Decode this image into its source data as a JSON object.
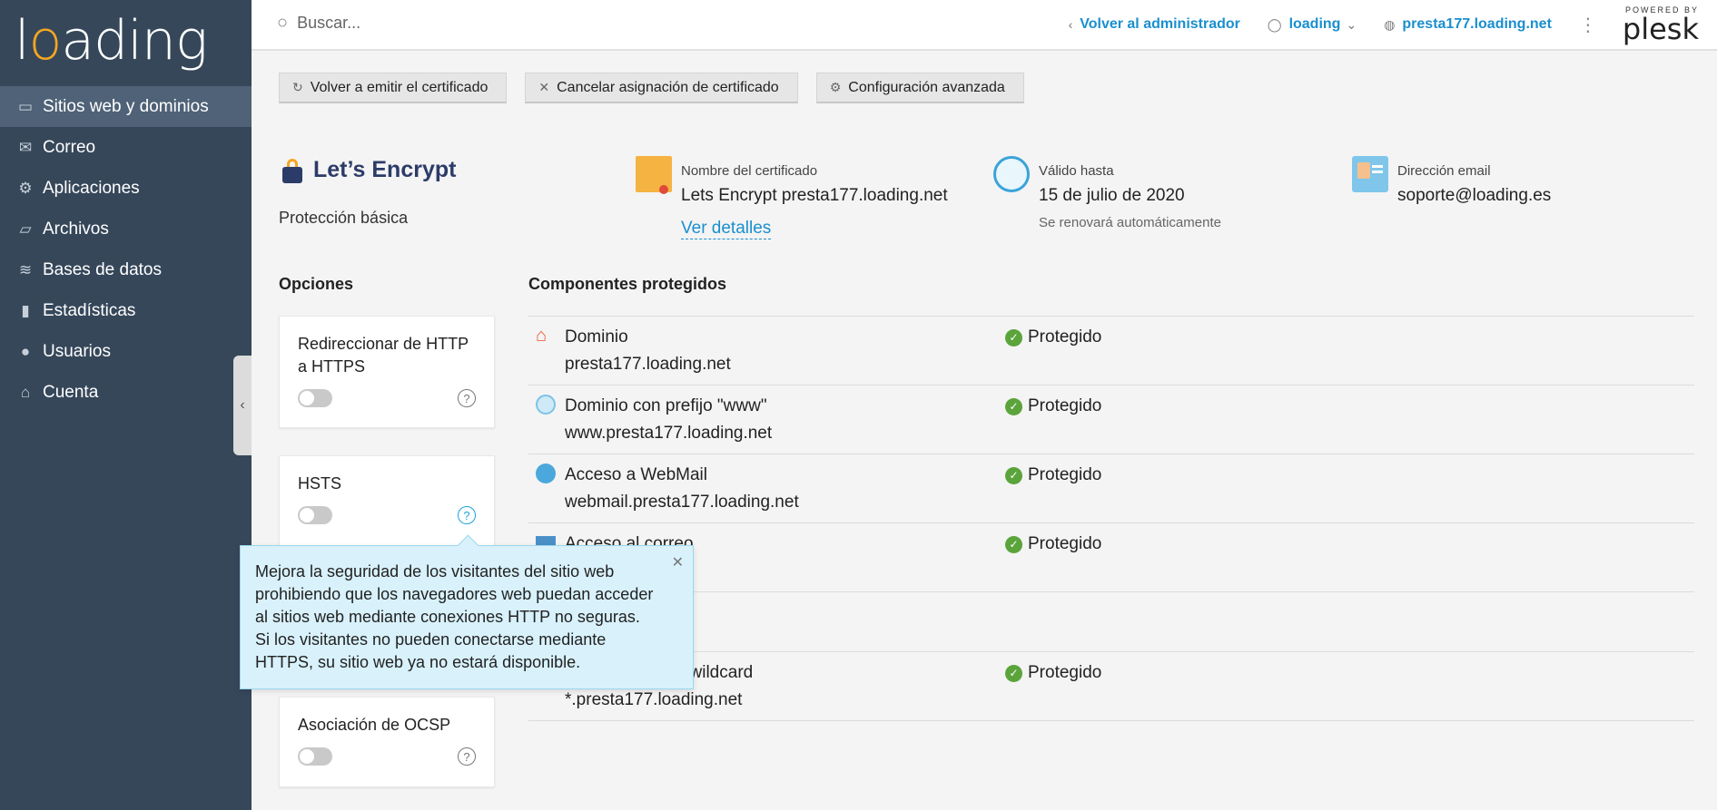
{
  "sidebar": {
    "logo": "loading",
    "items": [
      {
        "label": "Sitios web y dominios",
        "icon": "monitor-icon"
      },
      {
        "label": "Correo",
        "icon": "mail-icon"
      },
      {
        "label": "Aplicaciones",
        "icon": "gear-icon"
      },
      {
        "label": "Archivos",
        "icon": "folder-icon"
      },
      {
        "label": "Bases de datos",
        "icon": "database-icon"
      },
      {
        "label": "Estadísticas",
        "icon": "bar-chart-icon"
      },
      {
        "label": "Usuarios",
        "icon": "user-icon"
      },
      {
        "label": "Cuenta",
        "icon": "account-icon"
      }
    ]
  },
  "topbar": {
    "search_placeholder": "Buscar...",
    "back_admin": "Volver al administrador",
    "user": "loading",
    "domain": "presta177.loading.net",
    "powered_by": "POWERED BY",
    "brand": "plesk"
  },
  "toolbar": {
    "reissue": "Volver a emitir el certificado",
    "cancel": "Cancelar asignación de certificado",
    "advanced": "Configuración avanzada"
  },
  "certificate": {
    "provider": "Let’s Encrypt",
    "protection": "Protección básica",
    "name_label": "Nombre del certificado",
    "name_value": "Lets Encrypt presta177.loading.net",
    "details_link": "Ver detalles",
    "valid_label": "Válido hasta",
    "valid_value": "15 de julio de 2020",
    "renew_note": "Se renovará automáticamente",
    "email_label": "Dirección email",
    "email_value": "soporte@loading.es"
  },
  "options": {
    "heading": "Opciones",
    "items": [
      {
        "title": "Redireccionar de HTTP a HTTPS",
        "enabled": false
      },
      {
        "title": "HSTS",
        "enabled": false
      },
      {
        "title": "Asociación de OCSP",
        "enabled": false
      }
    ],
    "help_glyph": "?"
  },
  "tooltip": {
    "text": "Mejora la seguridad de los visitantes del sitio web prohibiendo que los navegadores web puedan acceder al sitios web mediante conexiones HTTP no seguras. Si los visitantes no pueden conectarse mediante HTTPS, su sitio web ya no estará disponible."
  },
  "components": {
    "heading": "Componentes protegidos",
    "rows": [
      {
        "name": "Dominio",
        "domain": "presta177.loading.net",
        "status": "Protegido",
        "icon": "house-icon"
      },
      {
        "name": "Dominio con prefijo \"www\"",
        "domain": "www.presta177.loading.net",
        "status": "Protegido",
        "icon": "www-icon"
      },
      {
        "name": "Acceso a WebMail",
        "domain": "webmail.presta177.loading.net",
        "status": "Protegido",
        "icon": "globe-icon"
      },
      {
        "name": "Acceso al correo",
        "domain": "",
        "status": "Protegido",
        "icon": "envelope-icon"
      },
      {
        "name": "LS wildcard",
        "domain": "*.presta177.loading.net",
        "status": "Protegido",
        "icon": ""
      }
    ]
  }
}
